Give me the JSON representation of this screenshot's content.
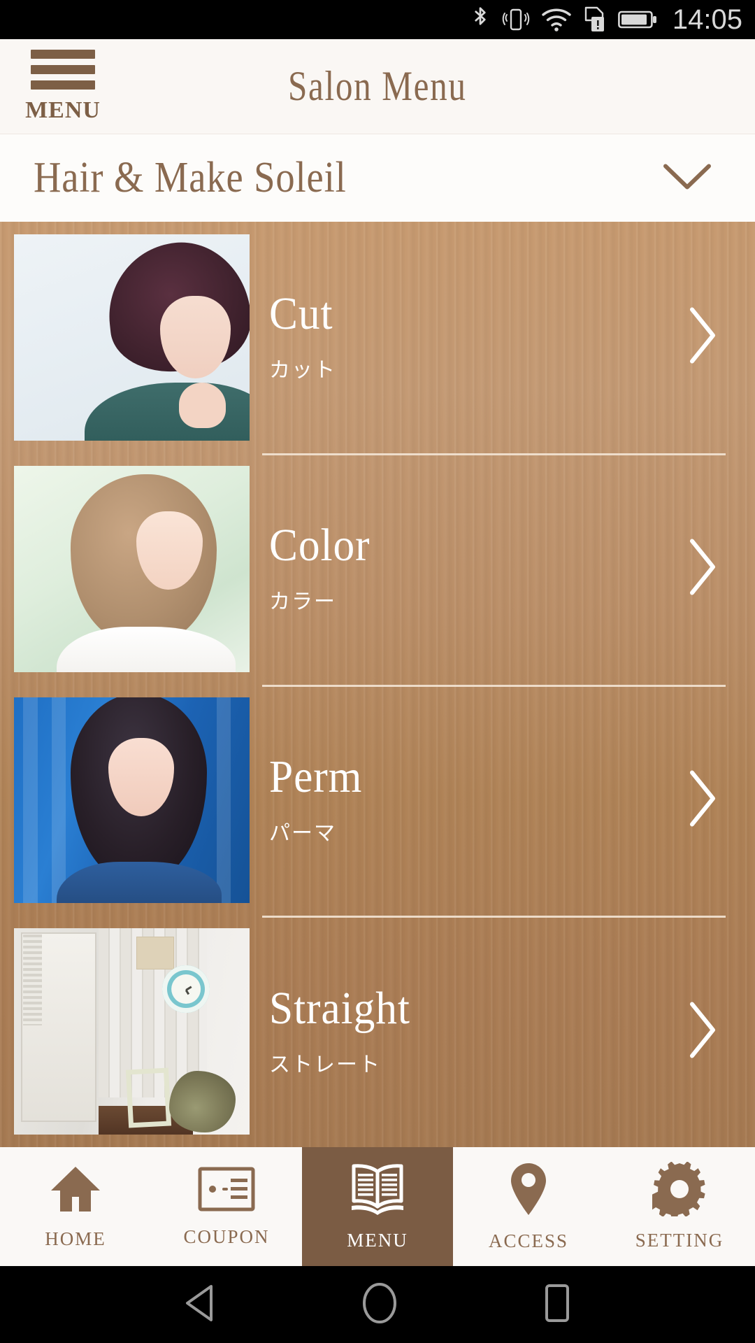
{
  "status_bar": {
    "time": "14:05",
    "icons": [
      "bluetooth-icon",
      "vibrate-icon",
      "wifi-icon",
      "sim-card-alert-icon",
      "battery-icon"
    ]
  },
  "header": {
    "menu_button_label": "MENU",
    "title": "Salon Menu"
  },
  "salon_bar": {
    "name": "Hair & Make Soleil",
    "expand_icon": "chevron-down-icon"
  },
  "menu_items": [
    {
      "en": "Cut",
      "jp": "カット",
      "thumb_alt": "short-dark-hair-model",
      "arrow": "chevron-right-icon"
    },
    {
      "en": "Color",
      "jp": "カラー",
      "thumb_alt": "beige-hair-model",
      "arrow": "chevron-right-icon"
    },
    {
      "en": "Perm",
      "jp": "パーマ",
      "thumb_alt": "wavy-hair-model-blue",
      "arrow": "chevron-right-icon"
    },
    {
      "en": "Straight",
      "jp": "ストレート",
      "thumb_alt": "salon-interior-photo",
      "arrow": "chevron-right-icon"
    }
  ],
  "tabs": [
    {
      "label": "HOME",
      "icon": "home-icon",
      "active": false
    },
    {
      "label": "COUPON",
      "icon": "ticket-icon",
      "active": false
    },
    {
      "label": "MENU",
      "icon": "book-icon",
      "active": true
    },
    {
      "label": "ACCESS",
      "icon": "map-pin-icon",
      "active": false
    },
    {
      "label": "SETTING",
      "icon": "gear-icon",
      "active": false
    }
  ],
  "android_nav": {
    "back": "back-triangle-icon",
    "home": "home-circle-icon",
    "recents": "recents-square-icon"
  },
  "colors": {
    "brand_brown": "#7b5c44",
    "title_brown": "#8a6a50",
    "header_bg": "#faf7f4",
    "wood_bg": "#bb8f68",
    "divider": "#f2e3d2",
    "tab_bg": "#faf8f6"
  }
}
